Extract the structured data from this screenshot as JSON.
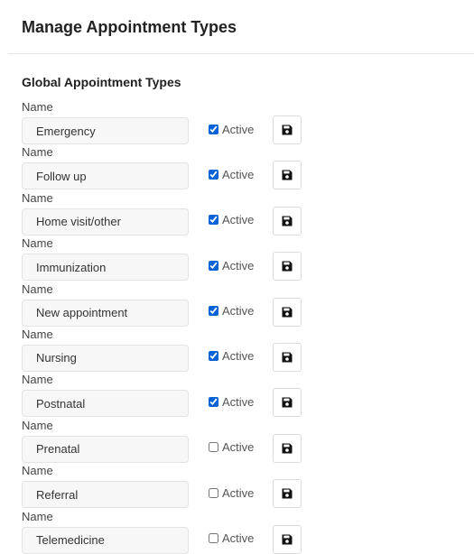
{
  "page": {
    "title": "Manage Appointment Types"
  },
  "section": {
    "title": "Global Appointment Types"
  },
  "field_label": "Name",
  "active_label": "Active",
  "icon": "save-icon",
  "types": [
    {
      "name": "Emergency",
      "active": true
    },
    {
      "name": "Follow up",
      "active": true
    },
    {
      "name": "Home visit/other",
      "active": true
    },
    {
      "name": "Immunization",
      "active": true
    },
    {
      "name": "New appointment",
      "active": true
    },
    {
      "name": "Nursing",
      "active": true
    },
    {
      "name": "Postnatal",
      "active": true
    },
    {
      "name": "Prenatal",
      "active": false
    },
    {
      "name": "Referral",
      "active": false
    },
    {
      "name": "Telemedicine",
      "active": false
    }
  ]
}
